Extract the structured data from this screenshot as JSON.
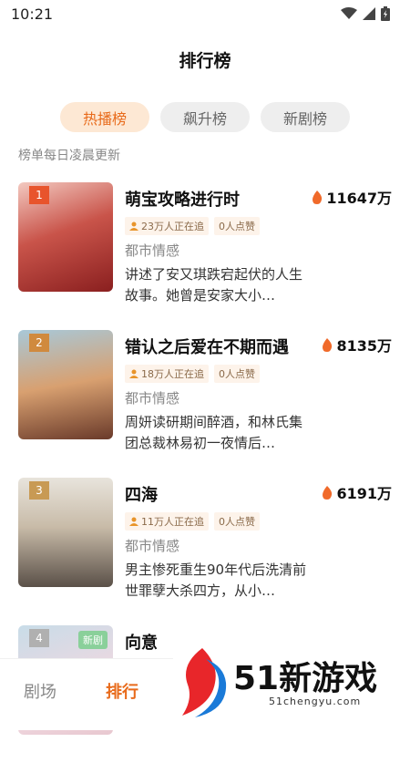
{
  "status_bar": {
    "time": "10:21"
  },
  "page_title": "排行榜",
  "tabs": [
    {
      "label": "热播榜",
      "active": true
    },
    {
      "label": "飙升榜",
      "active": false
    },
    {
      "label": "新剧榜",
      "active": false
    }
  ],
  "subtitle": "榜单每日凌晨更新",
  "items": [
    {
      "rank": "1",
      "title": "萌宝攻略进行时",
      "heat": "11647万",
      "followers": "23万人正在追",
      "likes": "0人点赞",
      "genre": "都市情感",
      "desc": "讲述了安又琪跌宕起伏的人生故事。她曾是安家大小…"
    },
    {
      "rank": "2",
      "title": "错认之后爱在不期而遇",
      "heat": "8135万",
      "followers": "18万人正在追",
      "likes": "0人点赞",
      "genre": "都市情感",
      "desc": "周妍读研期间醉酒，和林氏集团总裁林易初一夜情后…"
    },
    {
      "rank": "3",
      "title": "四海",
      "heat": "6191万",
      "followers": "11万人正在追",
      "likes": "0人点赞",
      "genre": "都市情感",
      "desc": "男主惨死重生90年代后洗清前世罪孽大杀四方，从小…"
    },
    {
      "rank": "4",
      "title": "向意",
      "badge": "新剧"
    }
  ],
  "bottom_nav": [
    {
      "label": "剧场",
      "active": false
    },
    {
      "label": "排行",
      "active": true
    }
  ],
  "watermark": {
    "brand": "51新游戏",
    "site": "51chengyu.com"
  },
  "colors": {
    "accent": "#e86a1a",
    "tab_active_bg": "#fde8d4"
  }
}
